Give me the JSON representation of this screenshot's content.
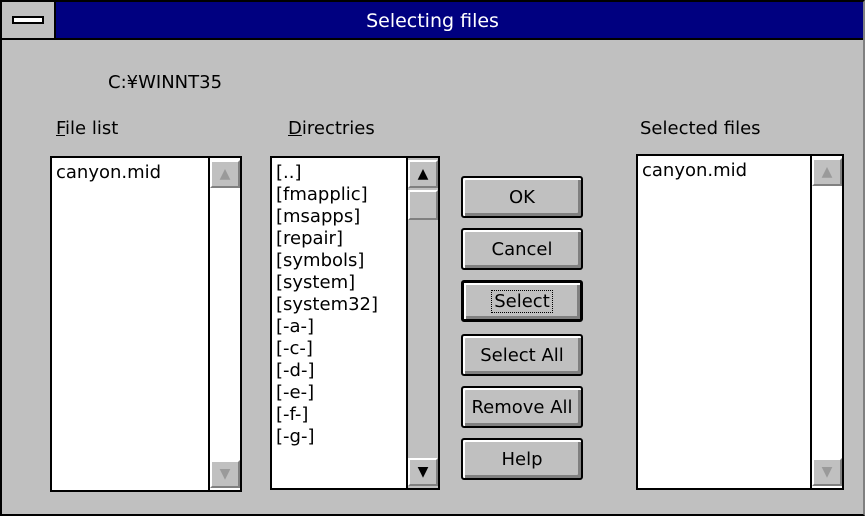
{
  "window": {
    "title": "Selecting files"
  },
  "current_path": "C:¥WINNT35",
  "file_list": {
    "label": "File list",
    "mnemonic": "F",
    "rest": "ile list",
    "items": [
      "canyon.mid"
    ]
  },
  "directories": {
    "label": "Directries",
    "mnemonic": "D",
    "rest": "irectries",
    "items": [
      "[..]",
      "[fmapplic]",
      "[msapps]",
      "[repair]",
      "[symbols]",
      "[system]",
      "[system32]",
      "[-a-]",
      "[-c-]",
      "[-d-]",
      "[-e-]",
      "[-f-]",
      "[-g-]"
    ]
  },
  "selected_files": {
    "label": "Selected files",
    "items": [
      "canyon.mid"
    ]
  },
  "buttons": {
    "ok": "OK",
    "cancel": "Cancel",
    "select": "Select",
    "select_all": "Select All",
    "remove_all": "Remove All",
    "help": "Help"
  }
}
